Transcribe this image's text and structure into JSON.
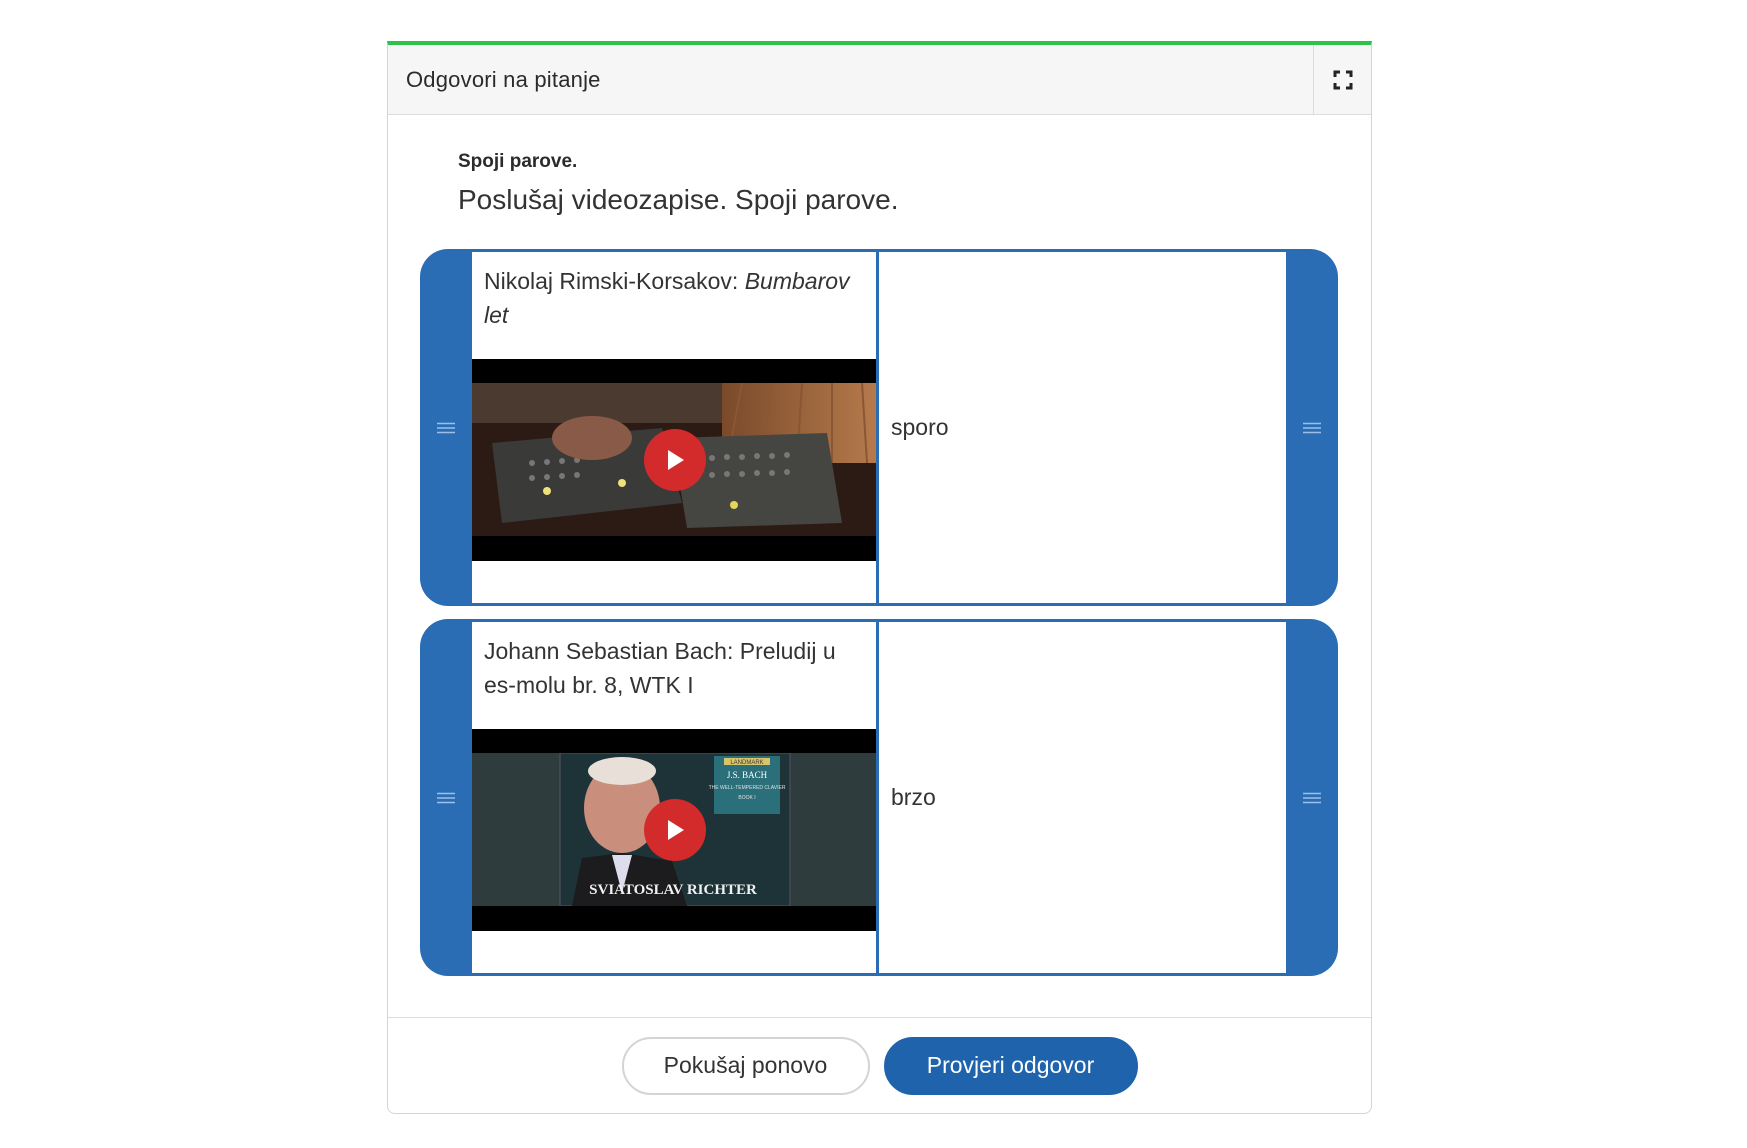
{
  "widget": {
    "title": "Odgovori na pitanje",
    "accent_color": "#2ec24a"
  },
  "task": {
    "label": "Spoji parove.",
    "instruction": "Poslušaj videozapise. Spoji parove."
  },
  "pairs": [
    {
      "title_plain": "Nikolaj Rimski-Korsakov: ",
      "title_italic": "Bumbarov let",
      "video_icon": "play-icon",
      "answer": "sporo"
    },
    {
      "title_plain": "Johann Sebastian Bach: Preludij u es-molu br. 8, WTK I",
      "video_icon": "play-icon",
      "answer": "brzo",
      "album_logo": "LANDMARK",
      "album_title": "J.S. BACH",
      "album_sub": "THE WELL-TEMPERED CLAVIER",
      "album_book": "BOOK I",
      "album_artist": "SVIATOSLAV RICHTER"
    }
  ],
  "buttons": {
    "retry": "Pokušaj ponovo",
    "check": "Provjeri odgovor"
  },
  "colors": {
    "pair_blue": "#2a6db5",
    "primary_button": "#1f63ac",
    "play_red": "#d32b2b"
  }
}
